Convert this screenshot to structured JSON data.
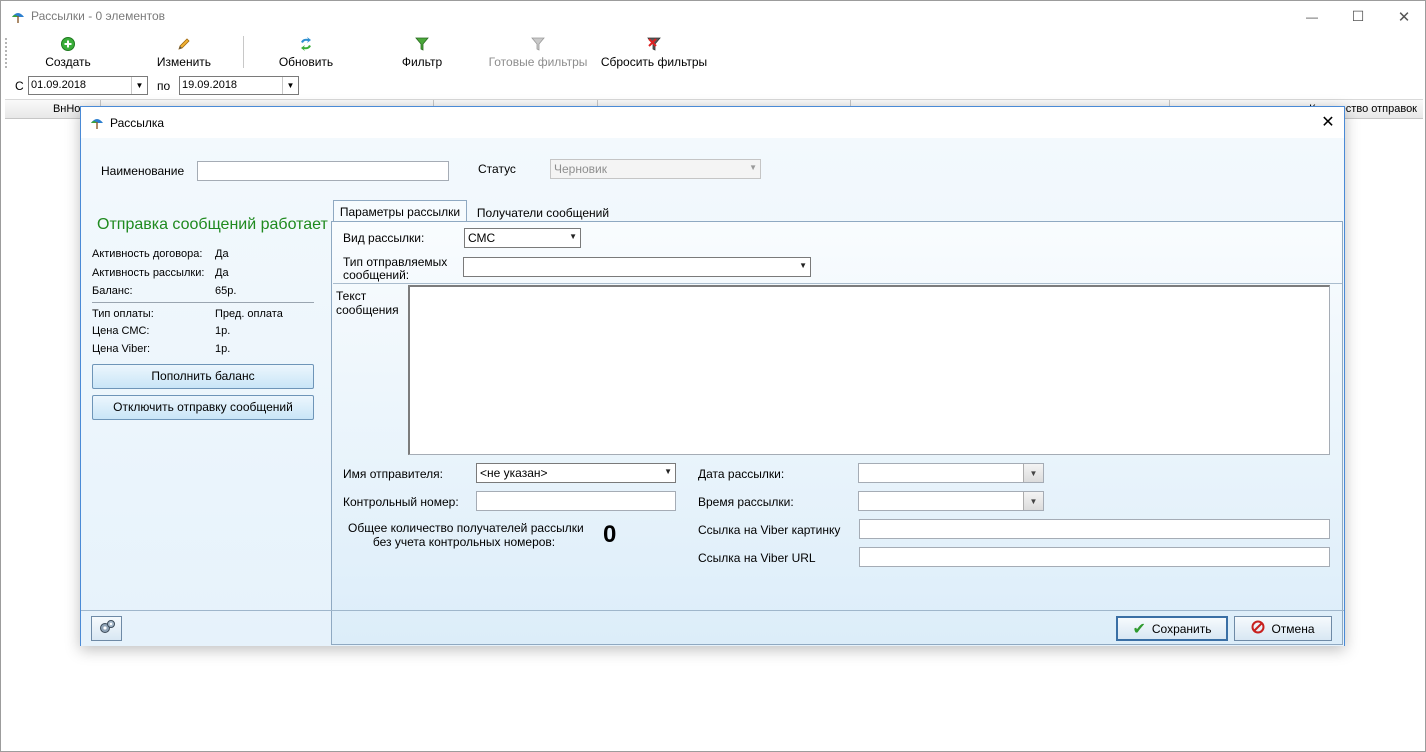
{
  "window": {
    "title": "Рассылки - 0 элементов",
    "minimize_glyph": "—",
    "maximize_glyph": "☐",
    "close_glyph": "✕"
  },
  "toolbar": {
    "create": "Создать",
    "edit": "Изменить",
    "refresh": "Обновить",
    "filter": "Фильтр",
    "ready_filters": "Готовые фильтры",
    "reset_filters": "Сбросить фильтры"
  },
  "date_range": {
    "from_label": "С",
    "from_value": "01.09.2018",
    "to_label": "по",
    "to_value": "19.09.2018"
  },
  "grid": {
    "col_internal_number": "ВнНом",
    "col_send_count": "Количество отправок"
  },
  "dialog": {
    "title": "Рассылка",
    "close_glyph": "✕",
    "name_label": "Наименование",
    "name_value": "",
    "status_label": "Статус",
    "status_value": "Черновик",
    "service_title": "Отправка сообщений работает",
    "info": [
      {
        "label": "Активность договора:",
        "value": "Да"
      },
      {
        "label": "Активность рассылки:",
        "value": "Да"
      },
      {
        "label": "Баланс:",
        "value": "65р."
      },
      {
        "label": "Тип оплаты:",
        "value": "Пред. оплата"
      },
      {
        "label": "Цена СМС:",
        "value": "1р."
      },
      {
        "label": "Цена Viber:",
        "value": "1р."
      }
    ],
    "topup_button": "Пополнить баланс",
    "disable_button": "Отключить отправку сообщений",
    "tabs": [
      {
        "label": "Параметры рассылки",
        "active": true
      },
      {
        "label": "Получатели сообщений",
        "active": false
      }
    ],
    "form": {
      "mailing_type_label": "Вид рассылки:",
      "mailing_type_value": "СМС",
      "message_type_label_line1": "Тип отправляемых",
      "message_type_label_line2": "сообщений:",
      "message_type_value": "",
      "text_label_line1": "Текст",
      "text_label_line2": "сообщения",
      "text_value": "",
      "sender_label": "Имя отправителя:",
      "sender_value": "<не указан>",
      "control_number_label": "Контрольный номер:",
      "control_number_value": "",
      "recipients_label_line1": "Общее количество получателей рассылки",
      "recipients_label_line2": "без учета контрольных номеров:",
      "recipients_count": "0",
      "date_label": "Дата рассылки:",
      "date_value": "",
      "time_label": "Время рассылки:",
      "time_value": "",
      "viber_image_label": "Ссылка на Viber картинку",
      "viber_image_value": "",
      "viber_url_label": "Ссылка на Viber URL",
      "viber_url_value": ""
    },
    "save_button": "Сохранить",
    "cancel_button": "Отмена"
  },
  "colors": {
    "accent_green": "#1f8a1f",
    "dialog_border": "#4a8ad6",
    "panel_bg": "#e6f2fb"
  }
}
